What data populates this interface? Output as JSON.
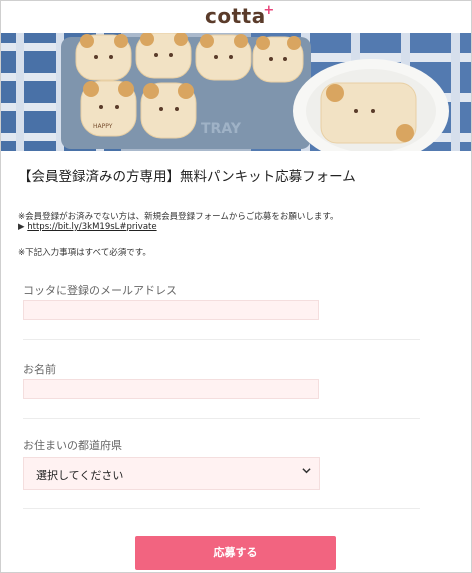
{
  "header": {
    "logo_text": "cotta",
    "logo_mark": "+"
  },
  "hero": {
    "alt_semantic": "bear-bread-photo",
    "tray_text": "TRAY",
    "bun_text": "HAPPY"
  },
  "form": {
    "title": "【会員登録済みの方専用】無料パンキット応募フォーム",
    "note_line1": "※会員登録がお済みでない方は、新規会員登録フォームからご応募をお願いします。",
    "note_link_prefix": "▶",
    "note_link": "https://bit.ly/3kM19sL#private",
    "note_required": "※下記入力事項はすべて必須です。",
    "email_label": "コッタに登録のメールアドレス",
    "email_value": "",
    "name_label": "お名前",
    "name_value": "",
    "prefecture_label": "お住まいの都道府県",
    "prefecture_selected": "選択してください",
    "submit_label": "応募する"
  },
  "colors": {
    "accent": "#f26480",
    "input_bg": "#fff2f2",
    "logo": "#5a3b2a",
    "logo_mark": "#e8457a"
  }
}
